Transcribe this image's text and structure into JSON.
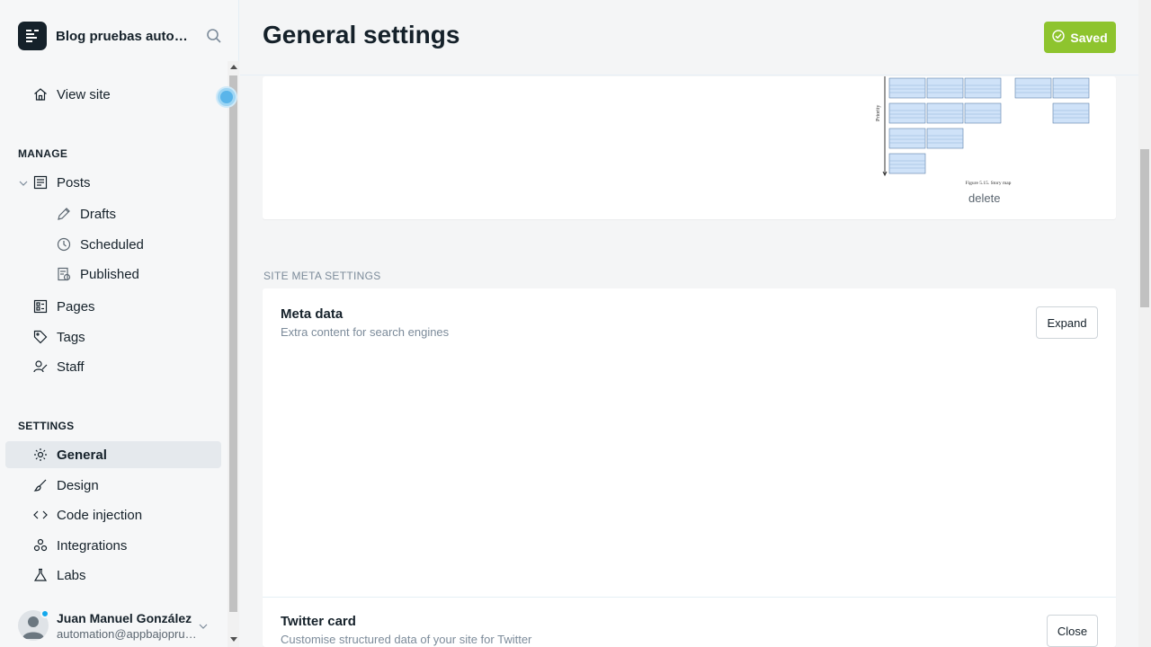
{
  "sidebar": {
    "blog_title": "Blog pruebas automatizadas",
    "view_site": "View site",
    "manage_label": "MANAGE",
    "posts": "Posts",
    "drafts": "Drafts",
    "scheduled": "Scheduled",
    "published": "Published",
    "pages": "Pages",
    "tags": "Tags",
    "staff": "Staff",
    "settings_label": "SETTINGS",
    "general": "General",
    "design": "Design",
    "code_injection": "Code injection",
    "integrations": "Integrations",
    "labs": "Labs",
    "user_name": "Juan Manuel González",
    "user_email": "automation@appbajopruebas.com"
  },
  "header": {
    "title": "General settings",
    "saved_label": "Saved"
  },
  "publication": {
    "delete_label": "delete",
    "image_caption": "Figure 5.15. Story map"
  },
  "meta": {
    "section_label": "SITE META SETTINGS",
    "meta_title": "Meta data",
    "meta_desc": "Extra content for search engines",
    "expand_label": "Expand",
    "twitter_title": "Twitter card",
    "twitter_desc": "Customise structured data of your site for Twitter",
    "close_label": "Close"
  },
  "colors": {
    "accent_green": "#8ec42e",
    "text_dark": "#15212a",
    "active_bg": "#e5e9ed"
  }
}
